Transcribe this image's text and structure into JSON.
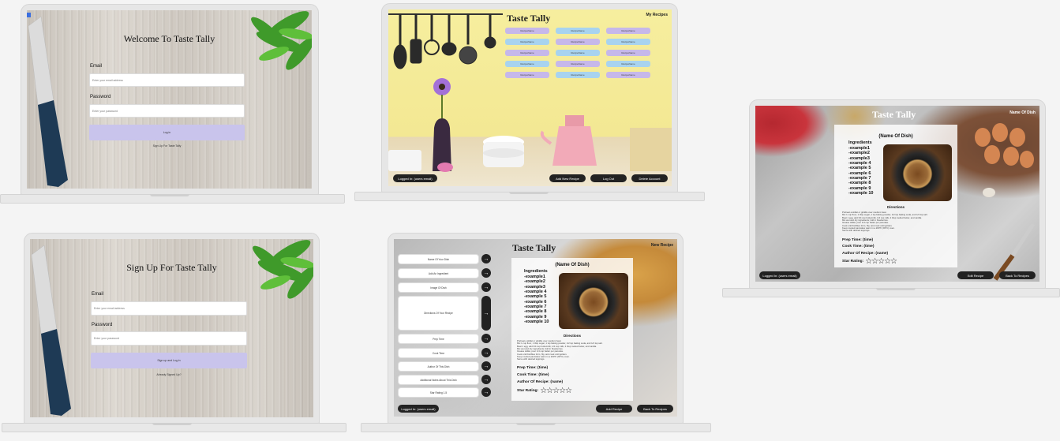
{
  "login": {
    "title": "Welcome To Taste Tally",
    "email_label": "Email",
    "email_placeholder": "Enter your email address",
    "password_label": "Password",
    "password_placeholder": "Enter your password",
    "login_button": "Log in",
    "signup_link": "Sign Up For Taste Tally"
  },
  "signup": {
    "title": "Sign Up For Taste Tally",
    "email_label": "Email",
    "email_placeholder": "Enter your email address",
    "password_label": "Password",
    "password_placeholder": "Enter your password",
    "signup_button": "Sign up and Log in",
    "login_link": "Already Signed Up?"
  },
  "recipes": {
    "title": "Taste Tally",
    "page_name": "My Recipes",
    "recipe_buttons": [
      "RecipeName",
      "RecipeName",
      "RecipeName",
      "RecipeName",
      "RecipeName",
      "RecipeName",
      "RecipeName",
      "RecipeName",
      "RecipeName",
      "RecipeName",
      "RecipeName",
      "RecipeName",
      "RecipeName",
      "RecipeName",
      "RecipeName"
    ],
    "logged_in": "Logged In: (users email)",
    "add_new": "Add New Recipe",
    "logout": "Log Out",
    "delete": "Delete Account"
  },
  "new_recipe": {
    "title": "Taste Tally",
    "page_name": "New Recipe",
    "fields": [
      "Name Of Your Dish",
      "Add An Ingredient",
      "Image Of Dish",
      "Directions Of Your Recipe",
      "Prep Time",
      "Cook Time",
      "Author Of This Dish",
      "Additional Notes About This Dish",
      "Star Rating 1-5"
    ],
    "dish_name": "(Name Of Dish)",
    "ingredients_heading": "Ingredients",
    "ingredients": [
      "-example1",
      "-example2",
      "-example3",
      "-example 4",
      "-example 5",
      "-example 6",
      "-example 7",
      "-example 8",
      "-example 9",
      "-example 10"
    ],
    "directions_heading": "Directions",
    "directions": [
      "Preheat a skillet or griddle over medium heat.",
      "Mix 1 cup flour, 1 tbsp sugar, 1 tsp baking powder, 1/2 tsp baking soda, and 1/4 tsp salt.",
      "Beat 1 egg, add 3/4 cup buttermilk, 1/4 cup milk, 2 tbsp melted butter, and vanilla.",
      "Mix wet and dry ingredients; fold in blueberries.",
      "Grease skillet, pour 1/4 cup batter per pancake.",
      "Cook until bubbles form, flip, and cook until golden.",
      "Keep cooked pancakes warm in a 200°F (93°C) oven.",
      "Serve with desired toppings."
    ],
    "prep_time": "Prep Time: (time)",
    "cook_time": "Cook Time: (time)",
    "author": "Author Of Recipe: (name)",
    "star_label": "Star Rating:",
    "stars": "☆☆☆☆☆",
    "logged_in": "Logged In: (users email)",
    "add_recipe": "Add Recipe",
    "back": "Back To Recipes"
  },
  "view_recipe": {
    "title": "Taste Tally",
    "page_name": "Name Of Dish",
    "dish_name": "(Name Of Dish)",
    "ingredients_heading": "Ingredients",
    "ingredients": [
      "-example1",
      "-example2",
      "-example3",
      "-example 4",
      "-example 5",
      "-example 6",
      "-example 7",
      "-example 8",
      "-example 9",
      "-example 10"
    ],
    "directions_heading": "Directions",
    "directions": [
      "Preheat a skillet or griddle over medium heat.",
      "Mix 1 cup flour, 1 tbsp sugar, 1 tsp baking powder, 1/2 tsp baking soda, and 1/4 tsp salt.",
      "Beat 1 egg, add 3/4 cup buttermilk, 1/4 cup milk, 2 tbsp melted butter, and vanilla.",
      "Mix wet and dry ingredients; fold in blueberries.",
      "Grease skillet, pour 1/4 cup batter per pancake.",
      "Cook until bubbles form, flip, and cook until golden.",
      "Keep cooked pancakes warm in a 200°F (93°C) oven.",
      "Serve with desired toppings."
    ],
    "prep_time": "Prep Time: (time)",
    "cook_time": "Cook Time: (time)",
    "author": "Author Of Recipe: (name)",
    "star_label": "Star Rating:",
    "stars": "☆☆☆☆☆",
    "logged_in": "Logged In: (users email)",
    "edit": "Edit Recipe",
    "back": "Back To Recipes"
  },
  "colors": {
    "lavender": "#c9c4ec",
    "pill_purple": "#c6b8ea",
    "pill_blue": "#a8d3ef",
    "yellow_wall": "#f4eb9b",
    "dark_button": "#222222"
  }
}
